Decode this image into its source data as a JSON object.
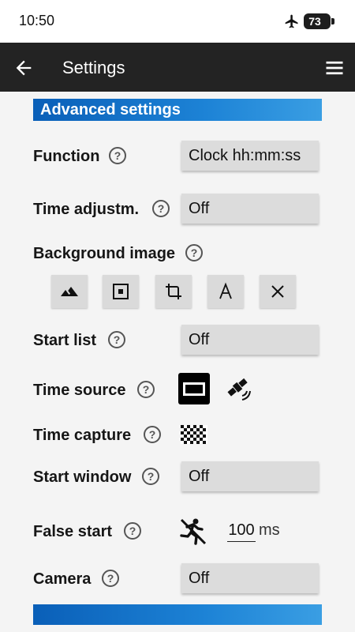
{
  "status_bar": {
    "time": "10:50",
    "battery": "73",
    "airplane_icon": "airplane-icon"
  },
  "app_bar": {
    "title": "Settings",
    "back_icon": "arrow-back-icon",
    "menu_icon": "hamburger-menu-icon"
  },
  "section": {
    "header": "Advanced settings"
  },
  "settings": {
    "function": {
      "label": "Function",
      "value": "Clock hh:mm:ss"
    },
    "time_adjustment": {
      "label": "Time adjustm.",
      "value": "Off"
    },
    "background_image": {
      "label": "Background image",
      "buttons": [
        "landscape-icon",
        "center-focus-icon",
        "crop-icon",
        "text-a-icon",
        "close-icon"
      ]
    },
    "start_list": {
      "label": "Start list",
      "value": "Off"
    },
    "time_source": {
      "label": "Time source",
      "icons": [
        "device-screen-icon",
        "satellite-icon"
      ]
    },
    "time_capture": {
      "label": "Time capture",
      "icon": "checkered-flag-icon"
    },
    "start_window": {
      "label": "Start window",
      "value": "Off"
    },
    "false_start": {
      "label": "False start",
      "icon": "runner-crossed-icon",
      "value": "100",
      "unit": "ms"
    },
    "camera": {
      "label": "Camera",
      "value": "Off"
    }
  },
  "colors": {
    "accent": "#0a5fb8",
    "appbar": "#232323",
    "background": "#f4f4f4",
    "field": "#dcdcdc"
  }
}
